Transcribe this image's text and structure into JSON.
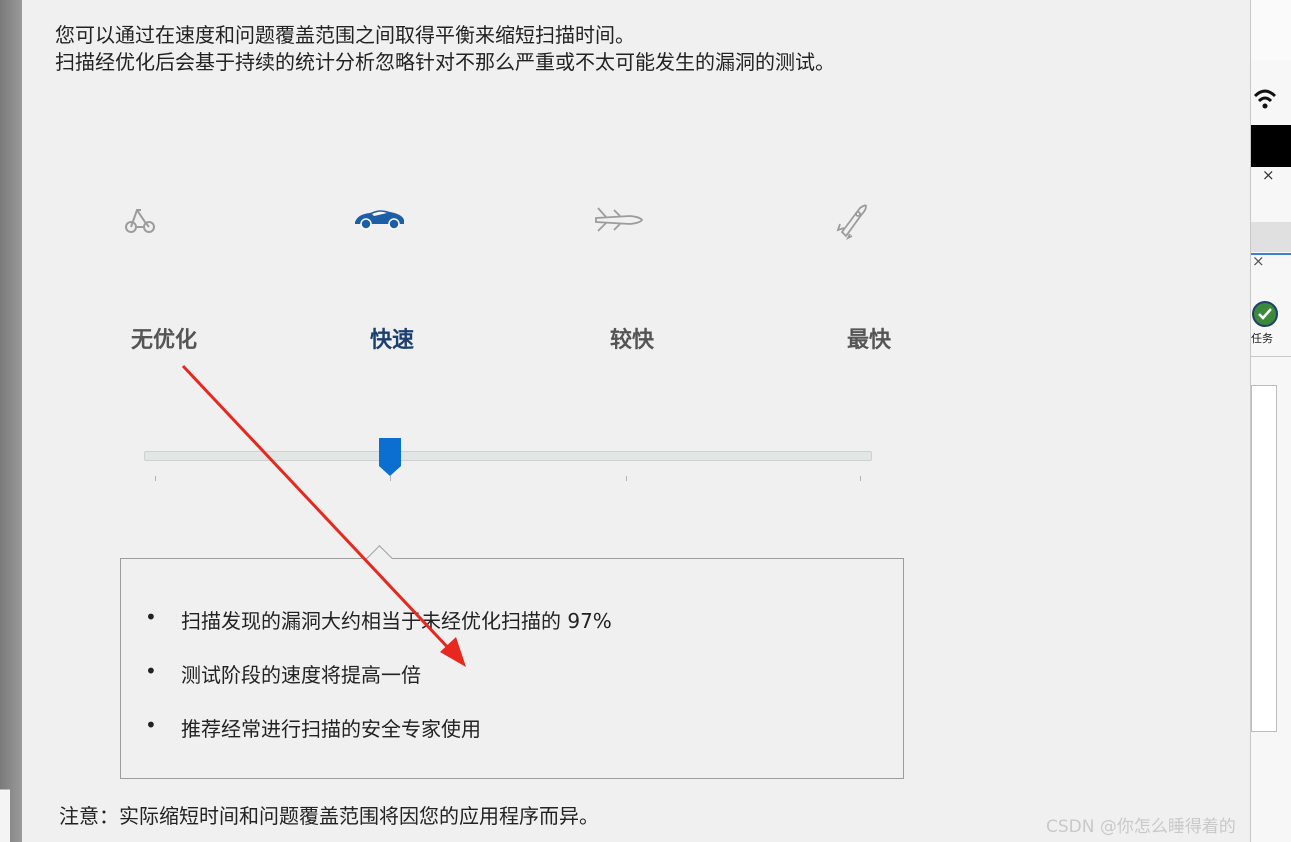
{
  "intro": {
    "line1": "您可以通过在速度和问题覆盖范围之间取得平衡来缩短扫描时间。",
    "line2": "扫描经优化后会基于持续的统计分析忽略针对不那么严重或不太可能发生的漏洞的测试。"
  },
  "levels": [
    {
      "label": "无优化",
      "icon": "scooter-icon"
    },
    {
      "label": "快速",
      "icon": "sports-car-icon"
    },
    {
      "label": "较快",
      "icon": "jet-plane-icon"
    },
    {
      "label": "最快",
      "icon": "rocket-icon"
    }
  ],
  "slider": {
    "selected_index": 1,
    "positions": 4
  },
  "info": {
    "bullets": [
      "扫描发现的漏洞大约相当于未经优化扫描的 97%",
      "测试阶段的速度将提高一倍",
      "推荐经常进行扫描的安全专家使用"
    ]
  },
  "note": "注意：实际缩短时间和问题覆盖范围将因您的应用程序而异。",
  "watermark": "CSDN @你怎么睡得着的",
  "right_pane": {
    "close_glyph": "×",
    "task_label": "任务"
  },
  "colors": {
    "accent": "#0a6fd0",
    "active_label": "#1b3f72",
    "annotation_arrow": "#e8281e"
  }
}
